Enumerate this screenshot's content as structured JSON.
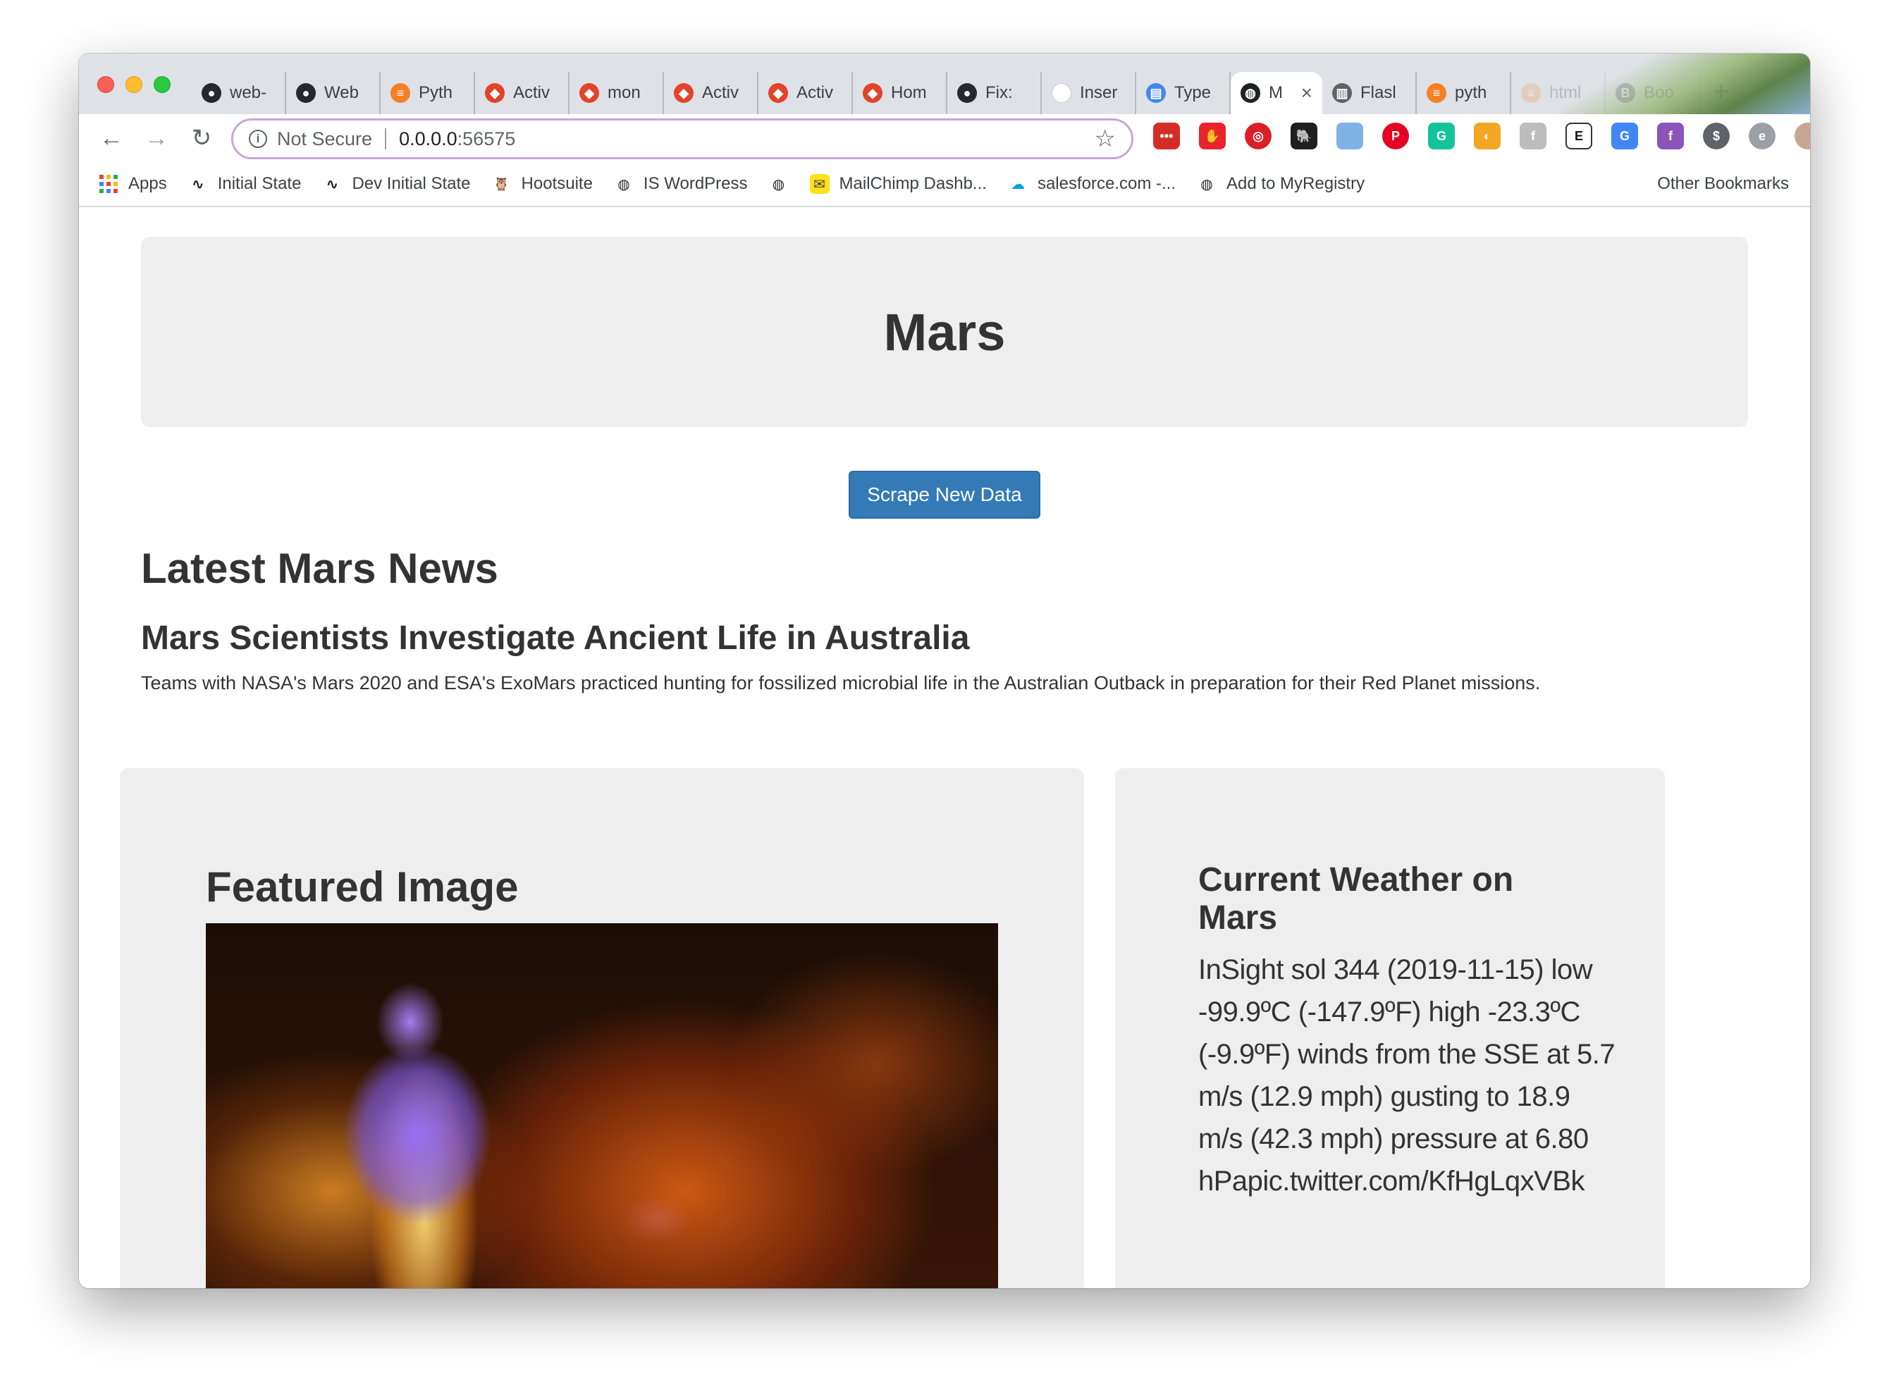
{
  "browser": {
    "tabs": [
      {
        "label": "web-",
        "icon": "github-icon",
        "color": "#24292e"
      },
      {
        "label": "Web",
        "icon": "github-icon",
        "color": "#24292e"
      },
      {
        "label": "Pyth",
        "icon": "stackoverflow-icon",
        "color": "#f48024"
      },
      {
        "label": "Activ",
        "icon": "gitlab-icon",
        "color": "#e24329"
      },
      {
        "label": "mon",
        "icon": "gitlab-icon",
        "color": "#e24329"
      },
      {
        "label": "Activ",
        "icon": "gitlab-icon",
        "color": "#e24329"
      },
      {
        "label": "Activ",
        "icon": "gitlab-icon",
        "color": "#e24329"
      },
      {
        "label": "Hom",
        "icon": "gitlab-icon",
        "color": "#e24329"
      },
      {
        "label": "Fix:",
        "icon": "github-icon",
        "color": "#24292e"
      },
      {
        "label": "Inser",
        "icon": "blank-icon",
        "color": "#ffffff"
      },
      {
        "label": "Type",
        "icon": "docs-icon",
        "color": "#4285f4"
      },
      {
        "label": "M",
        "icon": "globe-icon",
        "color": "#202124",
        "active": true
      },
      {
        "label": "Flasl",
        "icon": "book-icon",
        "color": "#5f6368"
      },
      {
        "label": "pyth",
        "icon": "stackoverflow-icon",
        "color": "#f48024"
      },
      {
        "label": "html",
        "icon": "stackoverflow-icon",
        "color": "#f48024"
      },
      {
        "label": "Boo",
        "icon": "bootstrap-icon",
        "color": "#563d7c"
      }
    ],
    "address": {
      "security_label": "Not Secure",
      "host": "0.0.0.0",
      "port": ":56575"
    },
    "bookmarks": [
      {
        "label": "Apps",
        "icon": "apps-grid-icon"
      },
      {
        "label": "Initial State",
        "icon": "initialstate-icon"
      },
      {
        "label": "Dev Initial State",
        "icon": "initialstate-icon"
      },
      {
        "label": "Hootsuite",
        "icon": "owl-icon"
      },
      {
        "label": "IS WordPress",
        "icon": "globe-icon"
      },
      {
        "label": "",
        "icon": "globe-icon"
      },
      {
        "label": "MailChimp Dashb...",
        "icon": "mailchimp-icon"
      },
      {
        "label": "salesforce.com -...",
        "icon": "salesforce-icon"
      },
      {
        "label": "Add to MyRegistry",
        "icon": "globe-icon"
      }
    ],
    "other_bookmarks": "Other Bookmarks",
    "extensions": [
      {
        "icon": "lastpass-icon",
        "color": "#d32d27",
        "text": "•••"
      },
      {
        "icon": "adblock-icon",
        "color": "#e8252b",
        "text": "✋"
      },
      {
        "icon": "creative-cloud-icon",
        "color": "#da1f26",
        "text": "◎"
      },
      {
        "icon": "evernote-icon",
        "color": "#1f1f1f",
        "text": "🐘"
      },
      {
        "icon": "window-icon",
        "color": "#7fb2e5",
        "text": ""
      },
      {
        "icon": "pinterest-icon",
        "color": "#e60023",
        "text": "P"
      },
      {
        "icon": "grammarly-icon",
        "color": "#15c39a",
        "text": "G"
      },
      {
        "icon": "color-icon",
        "color": "#f4a623",
        "text": "◐"
      },
      {
        "icon": "extension-icon",
        "color": "#bdbdbd",
        "text": "f"
      },
      {
        "icon": "evernote-web-icon",
        "color": "#ffffff",
        "text": "E"
      },
      {
        "icon": "translate-icon",
        "color": "#4285f4",
        "text": "G"
      },
      {
        "icon": "feedly-icon",
        "color": "#8a54b8",
        "text": "f"
      },
      {
        "icon": "dollar-icon",
        "color": "#5f6368",
        "text": "$"
      },
      {
        "icon": "edge-icon",
        "color": "#9aa0a6",
        "text": "e"
      },
      {
        "icon": "profile-avatar-icon",
        "color": "#c8a592",
        "text": ""
      },
      {
        "icon": "update-icon",
        "color": "#e53935",
        "text": "↑"
      }
    ]
  },
  "page": {
    "title": "Mars",
    "scrape_button": "Scrape New Data",
    "news_heading": "Latest Mars News",
    "news_title": "Mars Scientists Investigate Ancient Life in Australia",
    "news_paragraph": "Teams with NASA's Mars 2020 and ESA's ExoMars practiced hunting for fossilized microbial life in the Australian Outback in preparation for their Red Planet missions.",
    "featured_heading": "Featured Image",
    "weather_heading": "Current Weather on Mars",
    "weather_text": "InSight sol 344 (2019-11-15) low -99.9ºC (-147.9ºF) high -23.3ºC (-9.9ºF) winds from the SSE at 5.7 m/s (12.9 mph) gusting to 18.9 m/s (42.3 mph) pressure at 6.80 hPapic.twitter.com/KfHgLqxVBk"
  }
}
